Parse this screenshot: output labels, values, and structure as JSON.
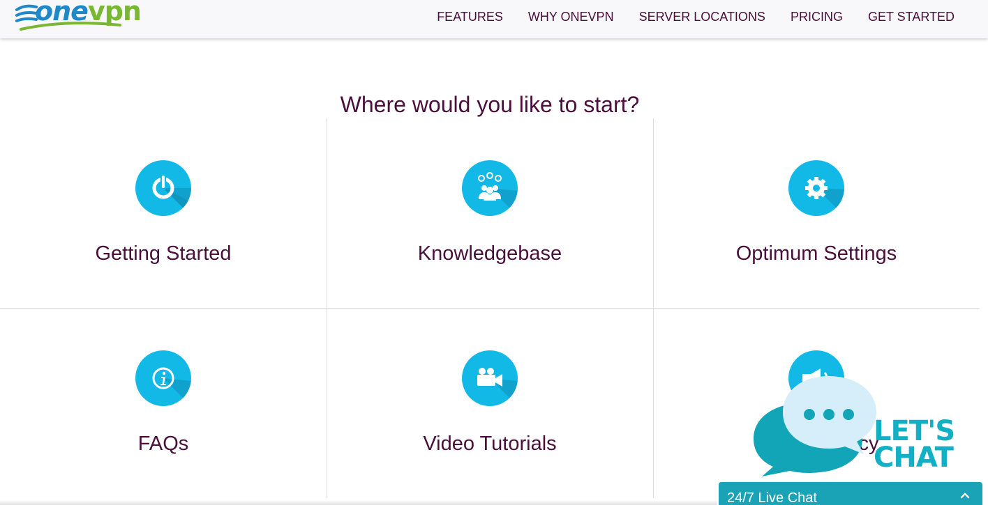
{
  "header": {
    "logo_one": "one",
    "logo_vpn": "vpn",
    "nav": [
      "FEATURES",
      "WHY ONEVPN",
      "SERVER LOCATIONS",
      "PRICING",
      "GET STARTED"
    ]
  },
  "main": {
    "title": "Where would you like to start?",
    "cards": [
      {
        "label": "Getting Started",
        "icon": "power-icon"
      },
      {
        "label": "Knowledgebase",
        "icon": "people-ideas-icon"
      },
      {
        "label": "Optimum Settings",
        "icon": "gear-icon"
      },
      {
        "label": "FAQs",
        "icon": "info-icon"
      },
      {
        "label": "Video Tutorials",
        "icon": "video-camera-icon"
      },
      {
        "label": "Refund Policy",
        "icon": "megaphone-icon"
      }
    ]
  },
  "chat": {
    "lets_chat_line1": "LET'S",
    "lets_chat_line2": "CHAT",
    "bar_label": "24/7 Live Chat"
  },
  "colors": {
    "accent": "#12b8e6",
    "text": "#4a0f3a",
    "chat": "#1aa3b6",
    "logo_blue": "#1e88c8",
    "logo_green": "#7ab833"
  }
}
